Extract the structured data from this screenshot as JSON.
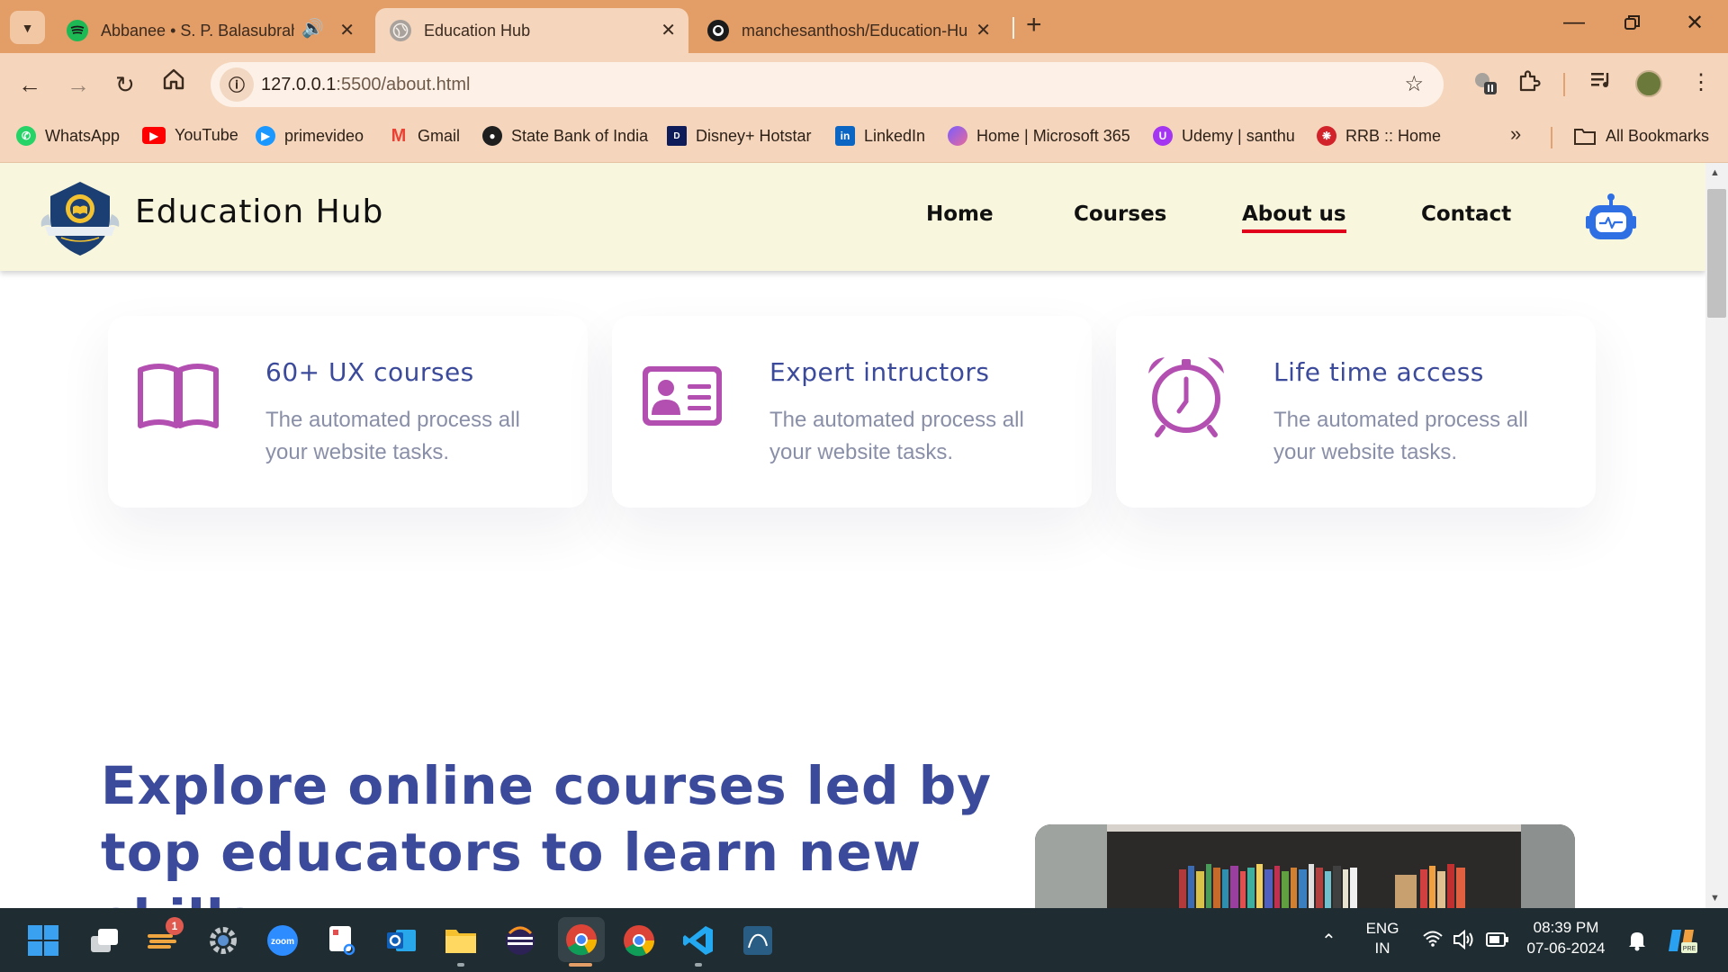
{
  "browser": {
    "tabs": [
      {
        "title": "Abbanee • S. P. Balasubrahm",
        "audio": true,
        "active": false
      },
      {
        "title": "Education Hub",
        "active": true
      },
      {
        "title": "manchesanthosh/Education-Hu",
        "active": false
      }
    ],
    "address": {
      "host": "127.0.0.1",
      "path": ":5500/about.html"
    },
    "bookmarks": [
      {
        "label": "WhatsApp",
        "color": "#25D366"
      },
      {
        "label": "YouTube",
        "color": "#FF0000"
      },
      {
        "label": "primevideo",
        "color": "#1A98FF"
      },
      {
        "label": "Gmail",
        "color": "#EA4335"
      },
      {
        "label": "State Bank of India",
        "color": "#22409a"
      },
      {
        "label": "Disney+ Hotstar",
        "color": "#0f1c5a"
      },
      {
        "label": "LinkedIn",
        "color": "#0A66C2"
      },
      {
        "label": "Home | Microsoft 365",
        "color": "#7b5cff"
      },
      {
        "label": "Udemy | santhu",
        "color": "#a435f0"
      },
      {
        "label": "RRB :: Home",
        "color": "#d2232a"
      }
    ],
    "all_bookmarks_label": "All Bookmarks"
  },
  "site": {
    "brand": "Education Hub",
    "nav": [
      {
        "label": "Home",
        "active": false
      },
      {
        "label": "Courses",
        "active": false
      },
      {
        "label": "About us",
        "active": true
      },
      {
        "label": "Contact",
        "active": false
      }
    ],
    "features": [
      {
        "title": "60+ UX courses",
        "description": "The automated process all your website tasks.",
        "icon": "book-icon"
      },
      {
        "title": "Expert intructors",
        "description": "The automated process all your website tasks.",
        "icon": "id-card-icon"
      },
      {
        "title": "Life time access",
        "description": "The automated process all your website tasks.",
        "icon": "alarm-clock-icon"
      }
    ],
    "hero_heading": "Explore online courses led by top educators to learn new skills.",
    "colors": {
      "accent": "#3b4a9a",
      "icon": "#b24fb0",
      "header_bg": "#f8f6dc",
      "active_underline": "#e0001b"
    }
  },
  "taskbar": {
    "notification_badge": "1",
    "language": {
      "line1": "ENG",
      "line2": "IN"
    },
    "time": "08:39 PM",
    "date": "07-06-2024"
  }
}
